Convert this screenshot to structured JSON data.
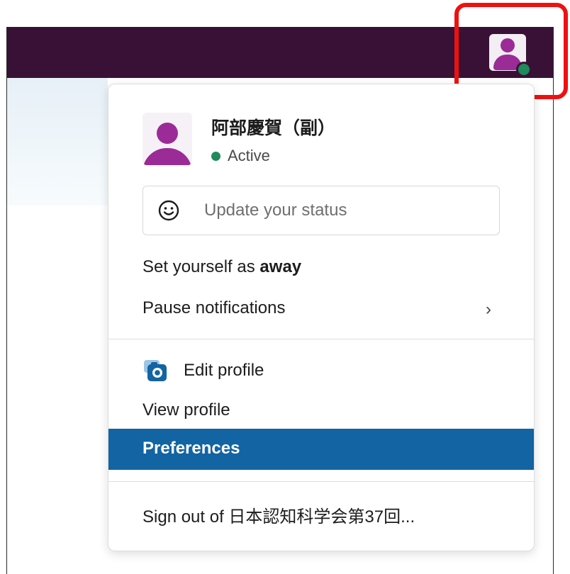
{
  "user": {
    "name": "阿部慶賀（副）",
    "presence": "Active"
  },
  "status": {
    "placeholder": "Update your status"
  },
  "menu": {
    "away_prefix": "Set yourself as ",
    "away_emphasis": "away",
    "pause_notifications": "Pause notifications",
    "chevron": "›",
    "edit_profile": "Edit profile",
    "view_profile": "View profile",
    "preferences": "Preferences",
    "sign_out": "Sign out of 日本認知科学会第37回..."
  },
  "colors": {
    "topbar": "#3a1136",
    "presence_green": "#1f8a5b",
    "selection_blue": "#1264a3",
    "highlight_red": "#ee1111",
    "avatar_purple": "#9b2b96"
  },
  "icons": [
    "user-avatar-icon",
    "smile-icon",
    "camera-icon",
    "chevron-right-icon"
  ]
}
